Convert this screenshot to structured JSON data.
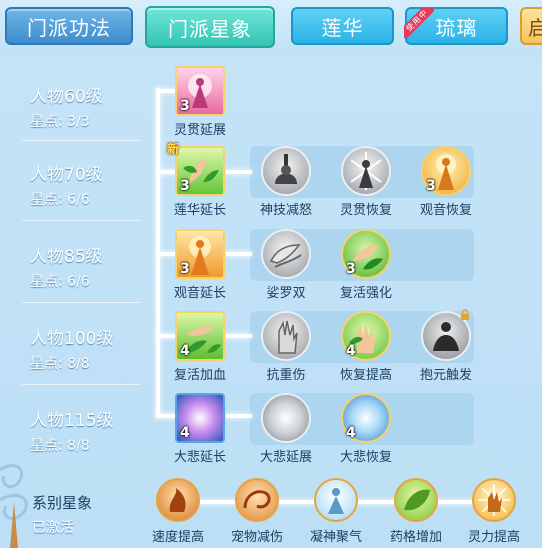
{
  "tabs": [
    {
      "label": "门派功法"
    },
    {
      "label": "门派星象"
    },
    {
      "label": "莲华"
    },
    {
      "label": "琉璃",
      "ribbon": "使用中"
    },
    {
      "label": "启"
    }
  ],
  "tiers": [
    {
      "title": "人物60级",
      "points": "星点: 3/3"
    },
    {
      "title": "人物70级",
      "points": "星点: 6/6"
    },
    {
      "title": "人物85级",
      "points": "星点: 6/6"
    },
    {
      "title": "人物100级",
      "points": "星点: 8/8"
    },
    {
      "title": "人物115级",
      "points": "星点: 8/8"
    }
  ],
  "skills": {
    "r1": [
      {
        "name": "灵贯延展",
        "level": "3"
      }
    ],
    "r2": [
      {
        "name": "莲华延长",
        "level": "3",
        "badge": "新"
      },
      {
        "name": "神技减怒",
        "level": ""
      },
      {
        "name": "灵贯恢复",
        "level": ""
      },
      {
        "name": "观音恢复",
        "level": "3"
      }
    ],
    "r3": [
      {
        "name": "观音延长",
        "level": "3"
      },
      {
        "name": "娑罗双",
        "level": ""
      },
      {
        "name": "复活强化",
        "level": "3"
      }
    ],
    "r4": [
      {
        "name": "复活加血",
        "level": "4"
      },
      {
        "name": "抗重伤",
        "level": ""
      },
      {
        "name": "恢复提高",
        "level": "4"
      },
      {
        "name": "抱元触发",
        "level": ""
      }
    ],
    "r5": [
      {
        "name": "大悲延长",
        "level": "4"
      },
      {
        "name": "大悲延展",
        "level": ""
      },
      {
        "name": "大悲恢复",
        "level": "4"
      }
    ]
  },
  "series": {
    "title": "系别星象",
    "status": "已激活",
    "skills": [
      {
        "name": "速度提高"
      },
      {
        "name": "宠物减伤"
      },
      {
        "name": "凝神聚气"
      },
      {
        "name": "药格增加"
      },
      {
        "name": "灵力提高"
      }
    ]
  },
  "icons": {
    "lock": "lock-icon"
  }
}
